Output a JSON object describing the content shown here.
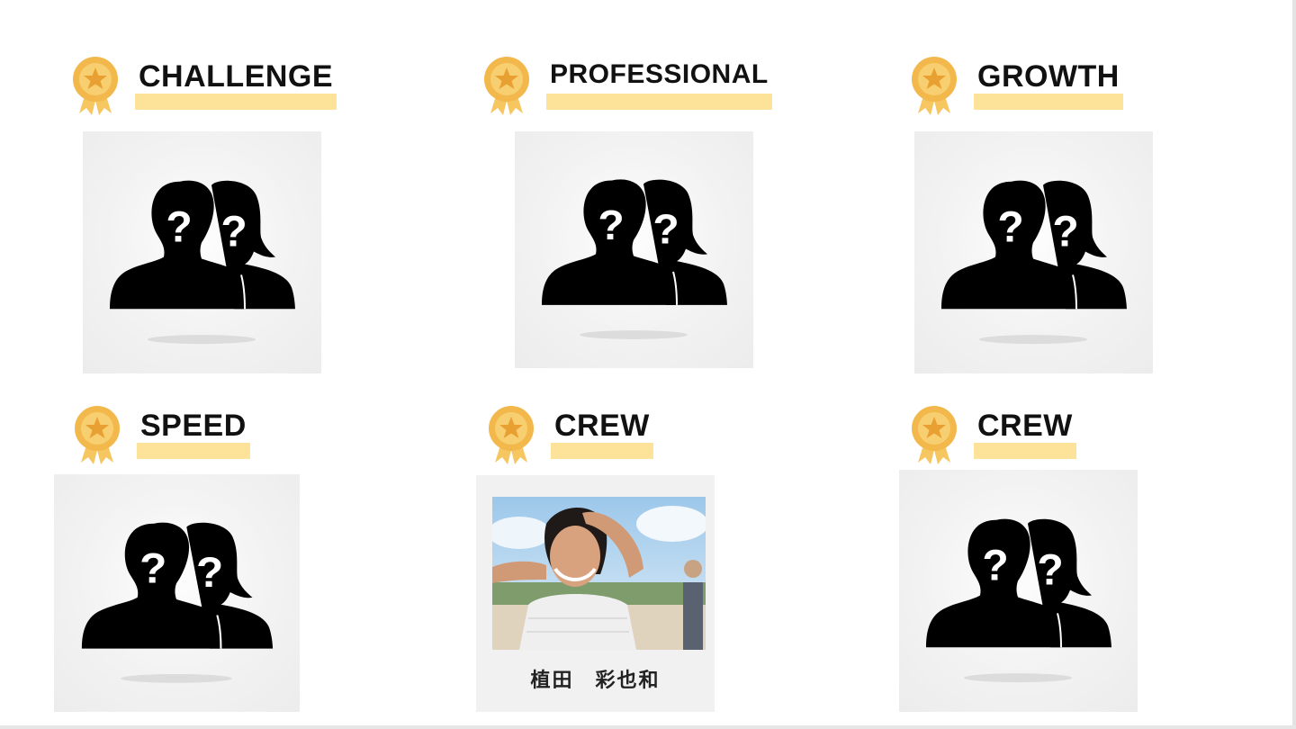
{
  "awards": [
    {
      "id": "challenge",
      "title": "CHALLENGE",
      "image": "unknown-person-icon"
    },
    {
      "id": "professional",
      "title": "PROFESSIONAL",
      "image": "unknown-person-icon"
    },
    {
      "id": "growth",
      "title": "GROWTH",
      "image": "unknown-person-icon"
    },
    {
      "id": "speed",
      "title": "SPEED",
      "image": "unknown-person-icon"
    },
    {
      "id": "crew1",
      "title": "CREW",
      "image": "photo",
      "caption": "植田　彩也和"
    },
    {
      "id": "crew2",
      "title": "CREW",
      "image": "unknown-person-icon"
    }
  ],
  "colors": {
    "medal": "#f2b84b",
    "highlight": "#fde39a",
    "card": "#f2f2f2"
  }
}
